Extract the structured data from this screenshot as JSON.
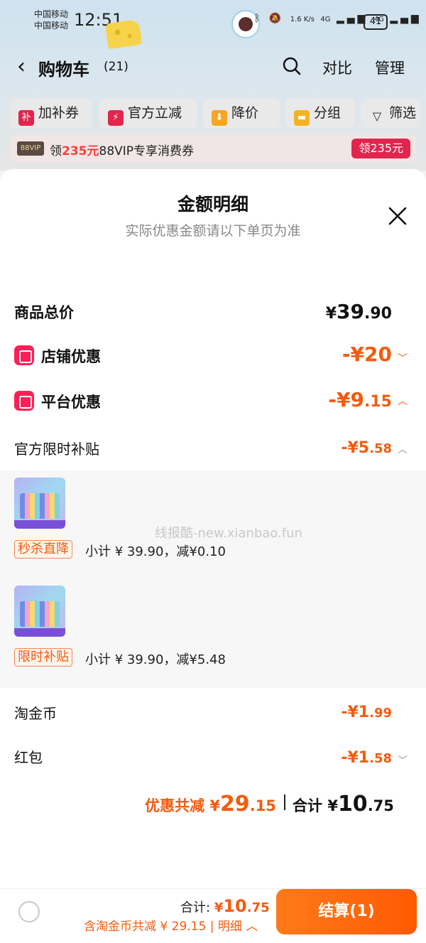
{
  "status_bar": {
    "carrier_1": "中国移动",
    "carrier_2": "中国移动",
    "time": "12:51",
    "net_speed": "1.6 K/s",
    "signal_1": "4G",
    "signal_2": "4G",
    "battery": "41"
  },
  "nav": {
    "title": "购物车",
    "count": "(21)",
    "compare": "对比",
    "manage": "管理"
  },
  "filters": [
    {
      "label": "加补券",
      "icon": "subsidy-icon",
      "icon_text": "补",
      "color": "#e2254d"
    },
    {
      "label": "官方立减",
      "icon": "lightning-icon",
      "icon_text": "⚡",
      "color": "#e2254d"
    },
    {
      "label": "降价",
      "icon": "down-arrow-icon",
      "icon_text": "⬇",
      "color": "#f5a623"
    },
    {
      "label": "分组",
      "icon": "folder-icon",
      "icon_text": "▬",
      "color": "#f5b321"
    },
    {
      "label": "筛选",
      "icon": "filter-icon",
      "icon_text": "▽",
      "color": "#222"
    }
  ],
  "vip_banner": {
    "tag": "88VIP",
    "prefix": "领",
    "amount": "235元",
    "suffix": "88VIP专享消费券",
    "button": "领235元"
  },
  "sheet": {
    "title": "金额明细",
    "subtitle": "实际优惠金额请以下单页为准",
    "total_label": "商品总价",
    "total_symbol": "¥",
    "total_int": "39",
    "total_dec": ".90",
    "store_label": "店铺优惠",
    "store_value": "-¥20",
    "platform_label": "平台优惠",
    "platform_int": "-¥9",
    "platform_dec": ".15",
    "official_label": "官方限时补贴",
    "official_int": "-¥5",
    "official_dec": ".58",
    "items": [
      {
        "tag": "秒杀直降",
        "subtotal": "小计 ¥ 39.90，减¥0.10"
      },
      {
        "tag": "限时补贴",
        "subtotal": "小计 ¥ 39.90，减¥5.48"
      }
    ],
    "watermark": "线报酷-new.xianbao.fun",
    "coin_label": "淘金币",
    "coin_int": "-¥1",
    "coin_dec": ".99",
    "redpack_label": "红包",
    "redpack_int": "-¥1",
    "redpack_dec": ".58",
    "discount_label": "优惠共减",
    "discount_symbol": "¥",
    "discount_int": "29",
    "discount_dec": ".15",
    "sum_label": "合计",
    "sum_symbol": "¥",
    "sum_int": "10",
    "sum_dec": ".75"
  },
  "bottom": {
    "total_label": "合计:",
    "total_symbol": "¥",
    "total_int": "10",
    "total_dec": ".75",
    "detail": "含淘金币共减 ¥ 29.15 | 明细 ︿",
    "checkout": "结算(1)"
  },
  "colors": {
    "accent": "#f45b0f",
    "red": "#ff1f57",
    "vip_red": "#e2254d"
  }
}
